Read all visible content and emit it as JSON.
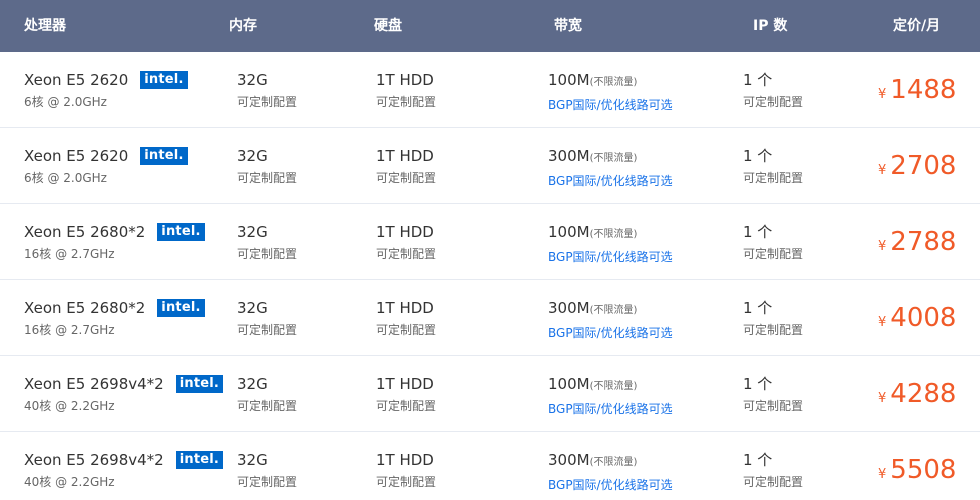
{
  "header": {
    "cpu": "处理器",
    "memory": "内存",
    "disk": "硬盘",
    "bandwidth": "带宽",
    "ip": "IP 数",
    "price": "定价/月"
  },
  "colors": {
    "header_bg": "#5d6a8a",
    "intel_badge": "#0068c9",
    "price": "#f05a28",
    "link": "#1a73e8"
  },
  "rows": [
    {
      "cpu": "Xeon E5 2620",
      "cpu_badge": "intel.",
      "cores": "6核 @ 2.0GHz",
      "memory": "32G",
      "memory_note": "可定制配置",
      "disk": "1T HDD",
      "disk_note": "可定制配置",
      "bandwidth": "100M",
      "bandwidth_note": "(不限流量)",
      "bandwidth_option": "BGP国际/优化线路可选",
      "ip": "1 个",
      "ip_note": "可定制配置",
      "currency": "¥",
      "price": "1488"
    },
    {
      "cpu": "Xeon E5 2620",
      "cpu_badge": "intel.",
      "cores": "6核 @ 2.0GHz",
      "memory": "32G",
      "memory_note": "可定制配置",
      "disk": "1T HDD",
      "disk_note": "可定制配置",
      "bandwidth": "300M",
      "bandwidth_note": "(不限流量)",
      "bandwidth_option": "BGP国际/优化线路可选",
      "ip": "1 个",
      "ip_note": "可定制配置",
      "currency": "¥",
      "price": "2708"
    },
    {
      "cpu": "Xeon E5 2680*2",
      "cpu_badge": "intel.",
      "cores": "16核 @ 2.7GHz",
      "memory": "32G",
      "memory_note": "可定制配置",
      "disk": "1T HDD",
      "disk_note": "可定制配置",
      "bandwidth": "100M",
      "bandwidth_note": "(不限流量)",
      "bandwidth_option": "BGP国际/优化线路可选",
      "ip": "1 个",
      "ip_note": "可定制配置",
      "currency": "¥",
      "price": "2788"
    },
    {
      "cpu": "Xeon E5 2680*2",
      "cpu_badge": "intel.",
      "cores": "16核 @ 2.7GHz",
      "memory": "32G",
      "memory_note": "可定制配置",
      "disk": "1T HDD",
      "disk_note": "可定制配置",
      "bandwidth": "300M",
      "bandwidth_note": "(不限流量)",
      "bandwidth_option": "BGP国际/优化线路可选",
      "ip": "1 个",
      "ip_note": "可定制配置",
      "currency": "¥",
      "price": "4008"
    },
    {
      "cpu": "Xeon E5 2698v4*2",
      "cpu_badge": "intel.",
      "cores": "40核 @ 2.2GHz",
      "memory": "32G",
      "memory_note": "可定制配置",
      "disk": "1T HDD",
      "disk_note": "可定制配置",
      "bandwidth": "100M",
      "bandwidth_note": "(不限流量)",
      "bandwidth_option": "BGP国际/优化线路可选",
      "ip": "1 个",
      "ip_note": "可定制配置",
      "currency": "¥",
      "price": "4288"
    },
    {
      "cpu": "Xeon E5 2698v4*2",
      "cpu_badge": "intel.",
      "cores": "40核 @ 2.2GHz",
      "memory": "32G",
      "memory_note": "可定制配置",
      "disk": "1T HDD",
      "disk_note": "可定制配置",
      "bandwidth": "300M",
      "bandwidth_note": "(不限流量)",
      "bandwidth_option": "BGP国际/优化线路可选",
      "ip": "1 个",
      "ip_note": "可定制配置",
      "currency": "¥",
      "price": "5508"
    }
  ]
}
